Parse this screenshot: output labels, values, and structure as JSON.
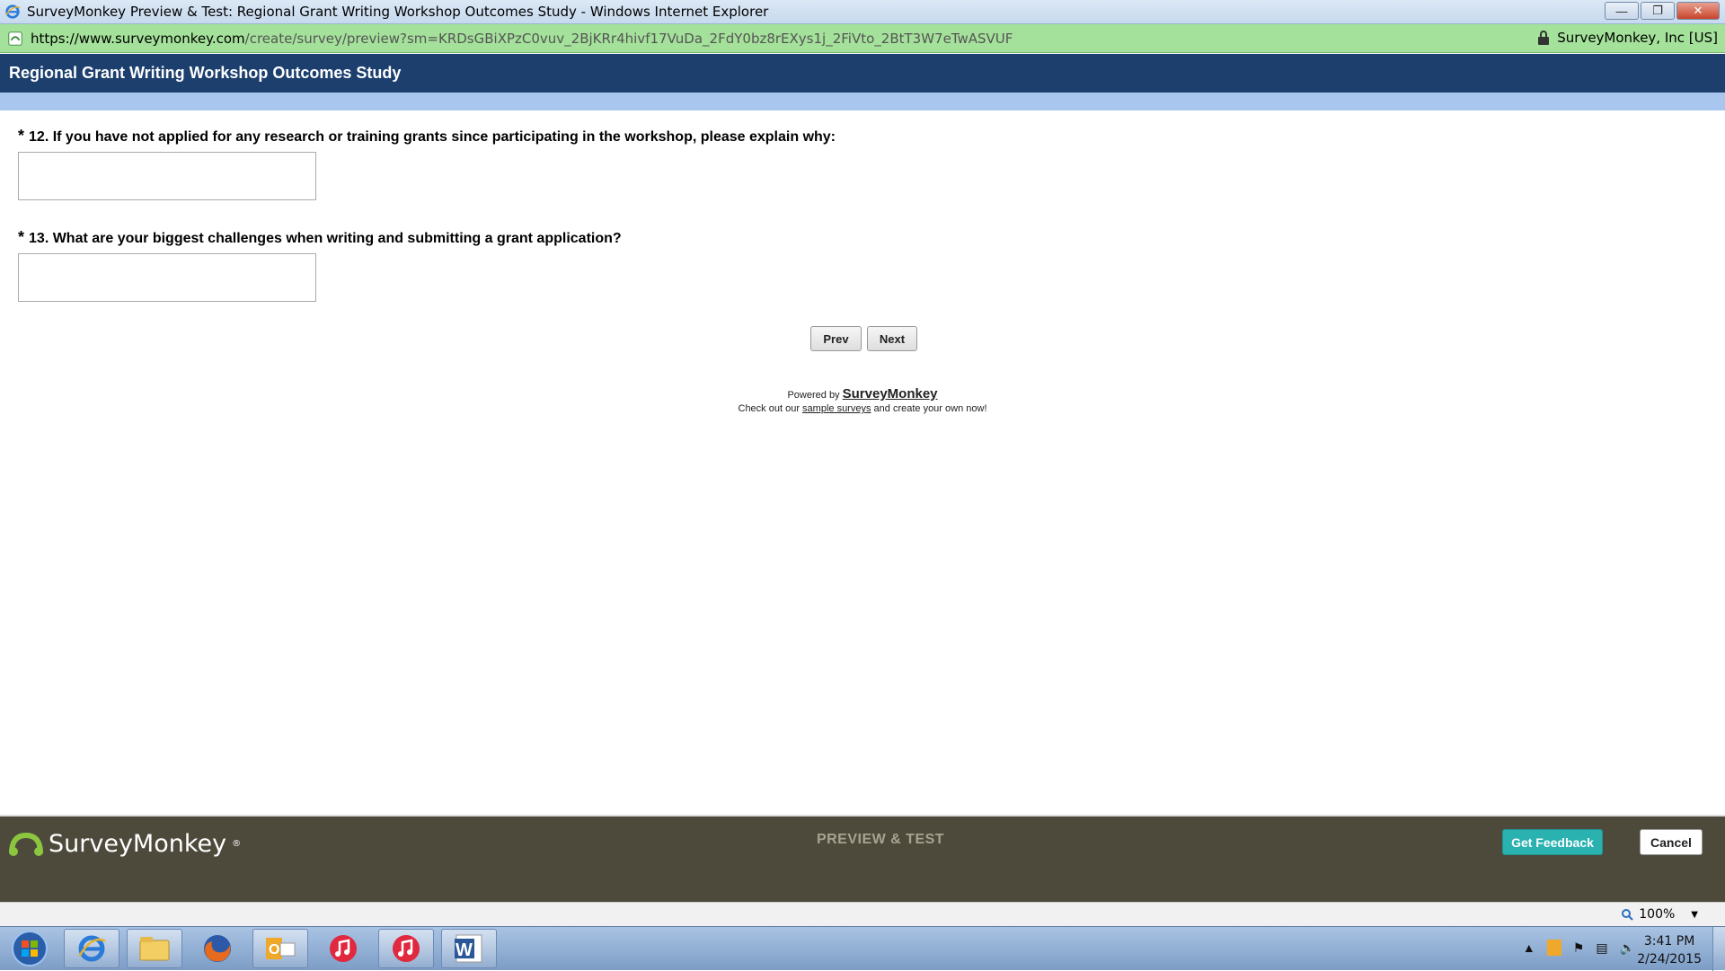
{
  "window": {
    "title": "SurveyMonkey Preview & Test: Regional Grant Writing Workshop Outcomes Study - Windows Internet Explorer",
    "minimize_icon": "minimize-icon",
    "restore_icon": "restore-icon",
    "close_icon": "close-icon"
  },
  "address": {
    "url_main": "https://www.surveymonkey.com",
    "url_rest": "/create/survey/preview?sm=KRDsGBiXPzC0vuv_2BjKRr4hivf17VuDa_2FdY0bz8rEXys1j_2FiVto_2BtT3W7eTwASVUF",
    "certificate": "SurveyMonkey, Inc [US]",
    "lock_icon": "lock-icon"
  },
  "survey": {
    "title": "Regional Grant Writing Workshop Outcomes Study",
    "questions": [
      {
        "required": "*",
        "text": "12. If you have not applied for any research or training grants since participating in the workshop, please explain why:",
        "value": ""
      },
      {
        "required": "*",
        "text": "13. What are your biggest challenges when writing and submitting a grant application?",
        "value": ""
      }
    ],
    "prev_label": "Prev",
    "next_label": "Next",
    "powered_by": "Powered by",
    "powered_brand": "SurveyMonkey",
    "checkout_before": "Check out our",
    "sample_link": "sample surveys",
    "checkout_after": "and create your own now!"
  },
  "preview_bar": {
    "brand": "SurveyMonkey",
    "reg_mark": "®",
    "label": "PREVIEW & TEST",
    "feedback_label": "Get Feedback",
    "cancel_label": "Cancel",
    "colors": {
      "background": "#4d4a3c",
      "feedback": "#29b2b0"
    }
  },
  "statusbar": {
    "zoom": "100%"
  },
  "taskbar": {
    "apps": [
      "internet-explorer-icon",
      "file-explorer-icon",
      "firefox-icon",
      "outlook-icon",
      "itunes-icon",
      "itunes-icon",
      "word-icon"
    ],
    "time": "3:41 PM",
    "date": "2/24/2015"
  }
}
